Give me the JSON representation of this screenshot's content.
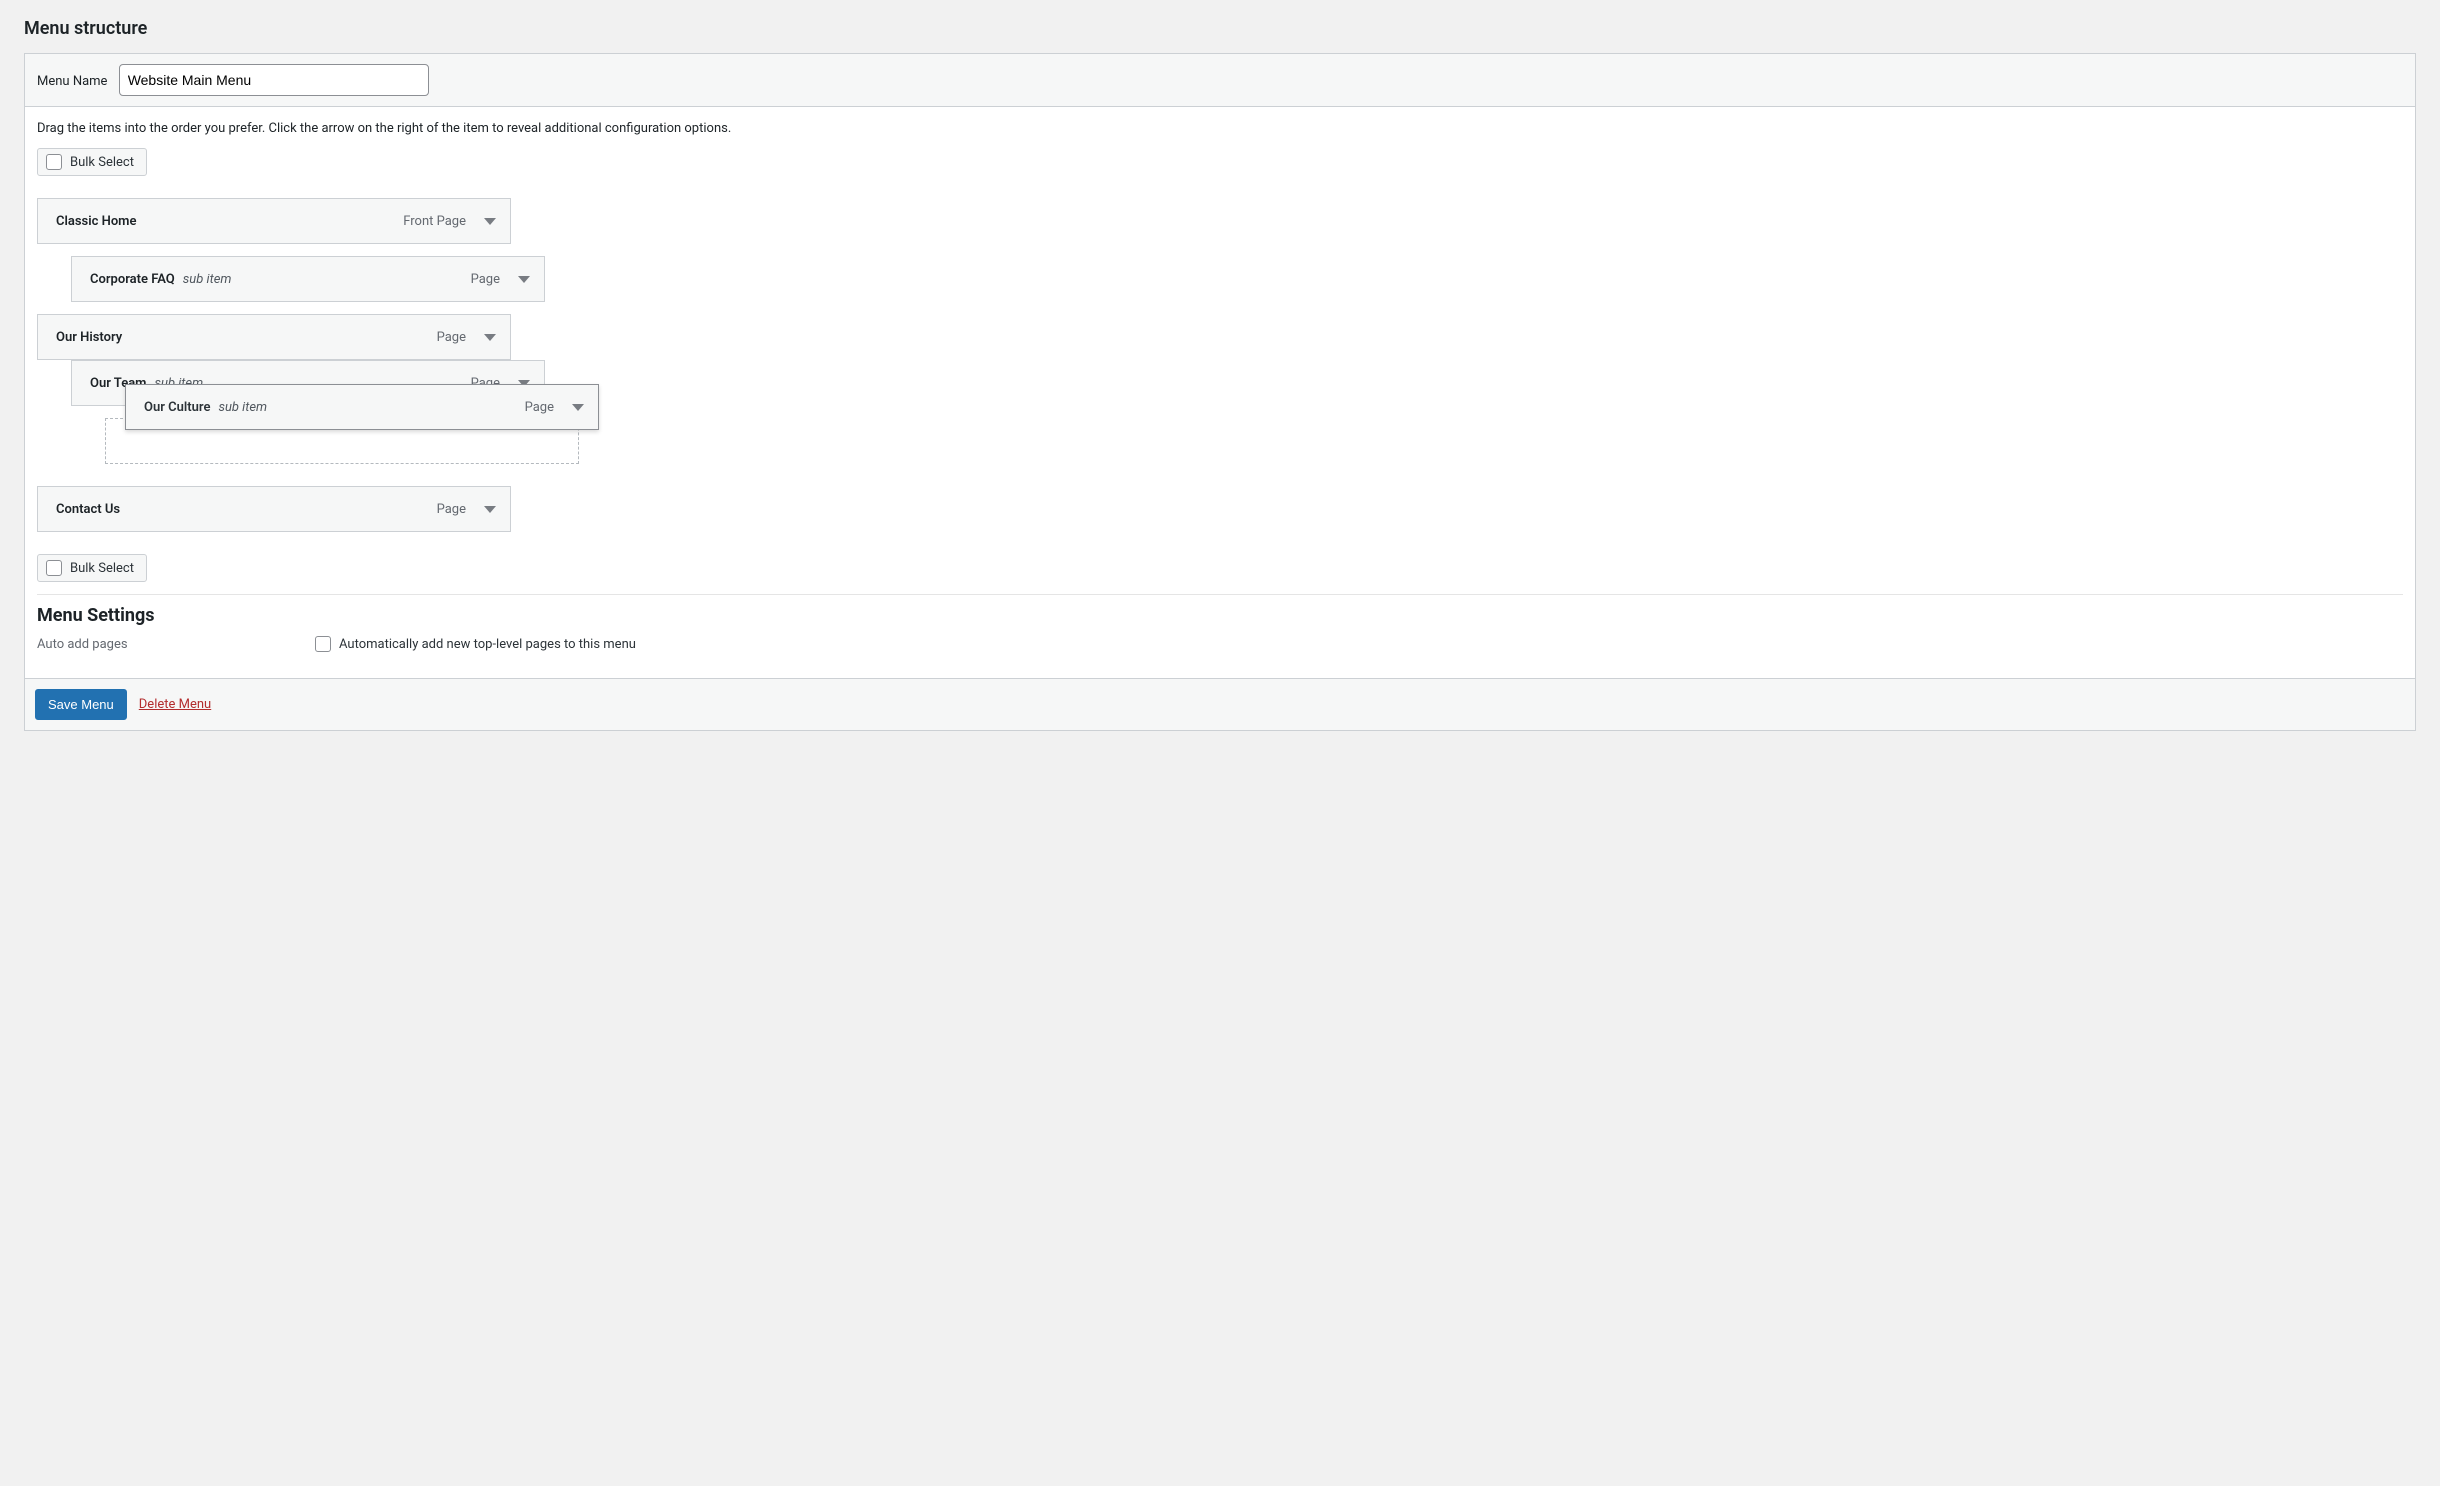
{
  "section_title": "Menu structure",
  "menu_name_label": "Menu Name",
  "menu_name_value": "Website Main Menu",
  "instructions": "Drag the items into the order you prefer. Click the arrow on the right of the item to reveal additional configuration options.",
  "bulk_select_label": "Bulk Select",
  "sub_item_suffix": "sub item",
  "items": [
    {
      "label": "Classic Home",
      "type": "Front Page",
      "depth": 0,
      "sub": false
    },
    {
      "label": "Corporate FAQ",
      "type": "Page",
      "depth": 1,
      "sub": true
    },
    {
      "label": "Our History",
      "type": "Page",
      "depth": 0,
      "sub": false
    },
    {
      "label": "Our Team",
      "type": "Page",
      "depth": 1,
      "sub": true
    }
  ],
  "dragging": {
    "label": "Our Culture",
    "type": "Page",
    "sub": true
  },
  "placeholder_depth": 2,
  "after_items": [
    {
      "label": "Contact Us",
      "type": "Page",
      "depth": 0,
      "sub": false
    }
  ],
  "settings_title": "Menu Settings",
  "settings": {
    "auto_add_key": "Auto add pages",
    "auto_add_label": "Automatically add new top-level pages to this menu"
  },
  "save_label": "Save Menu",
  "delete_label": "Delete Menu"
}
